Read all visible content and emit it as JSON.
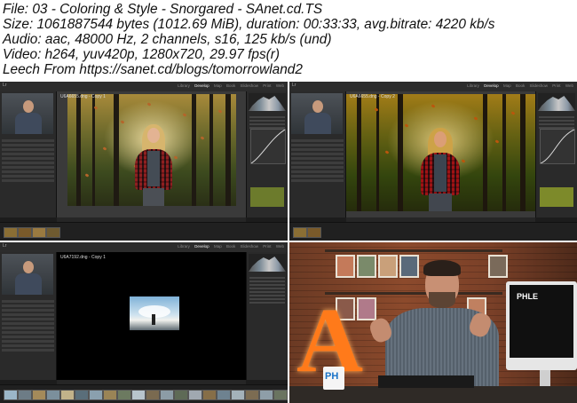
{
  "header": {
    "lines": [
      "File: 03 - Coloring & Style - Snorgared - SAnet.cd.TS",
      "Size: 1061887544 bytes (1012.69 MiB), duration: 00:33:33, avg.bitrate: 4220 kb/s",
      "Audio: aac, 48000 Hz, 2 channels, s16, 125 kb/s (und)",
      "Video: h264, yuv420p, 1280x720, 29.97 fps(r)",
      "Leech From https://sanet.cd/blogs/tomorrowland2"
    ]
  },
  "lightroom": {
    "modules": [
      "Library",
      "Develop",
      "Map",
      "Book",
      "Slideshow",
      "Print",
      "Web"
    ],
    "active_module": "Develop"
  },
  "thumbnails": [
    {
      "photo_label": "U6A6655.dng - Copy 1"
    },
    {
      "photo_label": "U6A6655.dng - Copy 2"
    },
    {
      "photo_label": "U6A7192.dng - Copy 1"
    }
  ],
  "presenter": {
    "monitor_text": "PHLE",
    "mug_text": "PH"
  },
  "colors": {
    "accent_orange": "#ff7a1a",
    "lr_dark": "#2a2a2a",
    "brand_blue": "#1a73c8"
  }
}
